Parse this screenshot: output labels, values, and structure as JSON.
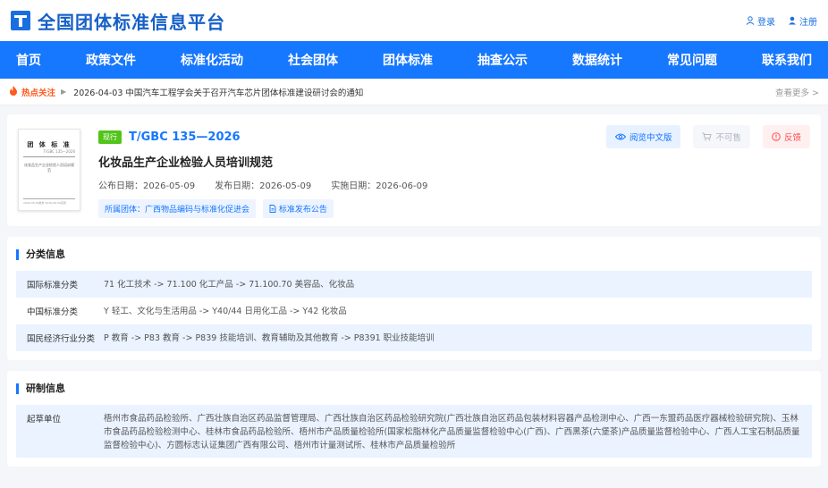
{
  "header": {
    "logo_text": "全国团体标准信息平台",
    "login": "登录",
    "register": "注册"
  },
  "nav": [
    "首页",
    "政策文件",
    "标准化活动",
    "社会团体",
    "团体标准",
    "抽查公示",
    "数据统计",
    "常见问题",
    "联系我们"
  ],
  "hot": {
    "label": "热点关注",
    "text": "2026-04-03  中国汽车工程学会关于召开汽车芯片团体标准建设研讨会的通知",
    "more": "查看更多 >"
  },
  "standard": {
    "cover_title": "团 体 标 准",
    "cover_code": "T/GBC 135—2026",
    "cover_name": "化妆品生产企业检验人员培训规范",
    "cover_foot": "2026-05-09发布  2026-06-09实施",
    "status": "现行",
    "code": "T/GBC 135—2026",
    "name": "化妆品生产企业检验人员培训规范",
    "publish_date": "公布日期：2026-05-09",
    "release_date": "发布日期：2026-05-09",
    "impl_date": "实施日期：2026-06-09",
    "org_tag": "所属团体：广西物品编码与标准化促进会",
    "notice_tag": "标准发布公告",
    "btn_read": "阅览中文版",
    "btn_buy": "不可售",
    "btn_feedback": "反馈"
  },
  "classification": {
    "title": "分类信息",
    "rows": [
      {
        "label": "国际标准分类",
        "value": "71 化工技术 -> 71.100 化工产品 -> 71.100.70 美容品、化妆品"
      },
      {
        "label": "中国标准分类",
        "value": "Y 轻工、文化与生活用品 -> Y40/44 日用化工品 -> Y42 化妆品"
      },
      {
        "label": "国民经济行业分类",
        "value": "P 教育 -> P83 教育 -> P839 技能培训、教育辅助及其他教育 -> P8391 职业技能培训"
      }
    ]
  },
  "development": {
    "title": "研制信息",
    "rows": [
      {
        "label": "起草单位",
        "value": "梧州市食品药品检验所、广西壮族自治区药品监督管理局、广西壮族自治区药品检验研究院(广西壮族自治区药品包装材料容器产品检测中心、广西一东盟药品医疗器械检验研究院)、玉林市食品药品检验检测中心、桂林市食品药品检验所、梧州市产品质量检验所(国家松脂林化产品质量监督检验中心(广西)、广西黑茶(六堡茶)产品质量监督检验中心、广西人工宝石制品质量监督检验中心)、方圆标志认证集团广西有限公司、梧州市计量测试所、桂林市产品质量检验所"
      }
    ]
  }
}
